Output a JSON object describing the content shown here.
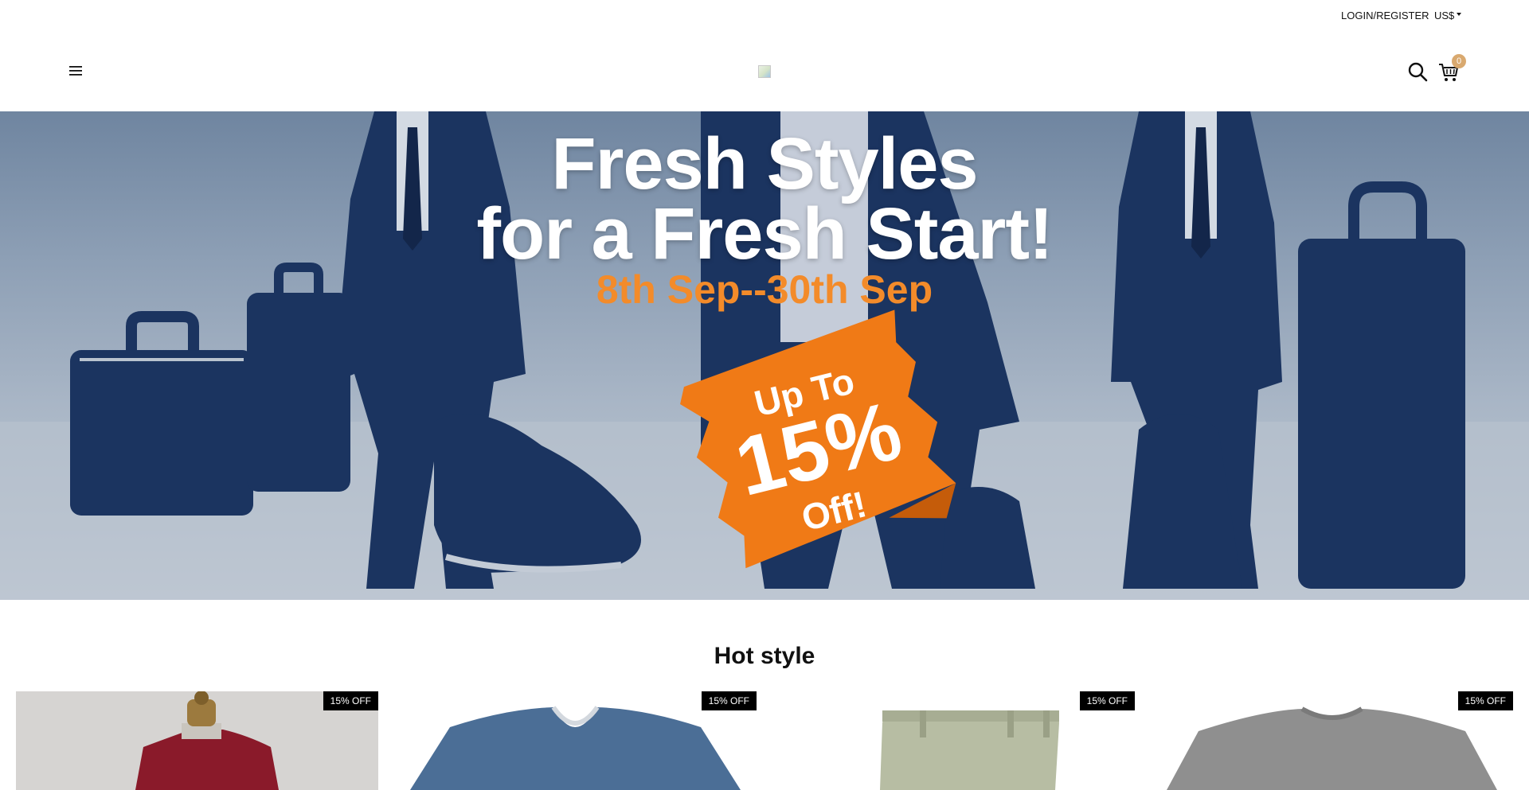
{
  "topbar": {
    "login_label": "LOGIN/REGISTER",
    "currency_label": "US$"
  },
  "header": {
    "menu_icon": "hamburger-menu-icon",
    "logo_icon": "broken-image-icon",
    "search_icon": "search-icon",
    "cart_icon": "cart-icon",
    "cart_count": "0",
    "cart_badge_color": "#d9a96f"
  },
  "hero": {
    "title_line1": "Fresh Styles",
    "title_line2": "for a Fresh Start!",
    "dates": "8th Sep--30th Sep",
    "promo_line1": "Up To",
    "promo_line2": "15%",
    "promo_line3": "Off!",
    "colors": {
      "navy": "#1b3460",
      "orange": "#f07a16",
      "dates_orange": "#f38b2a"
    }
  },
  "section": {
    "title": "Hot style"
  },
  "products": [
    {
      "badge": "15% OFF",
      "image": "red-sweater-on-mannequin"
    },
    {
      "badge": "15% OFF",
      "image": "blue-v-neck-tshirt"
    },
    {
      "badge": "15% OFF",
      "image": "khaki-pants"
    },
    {
      "badge": "15% OFF",
      "image": "grey-crew-neck-tshirt"
    }
  ]
}
